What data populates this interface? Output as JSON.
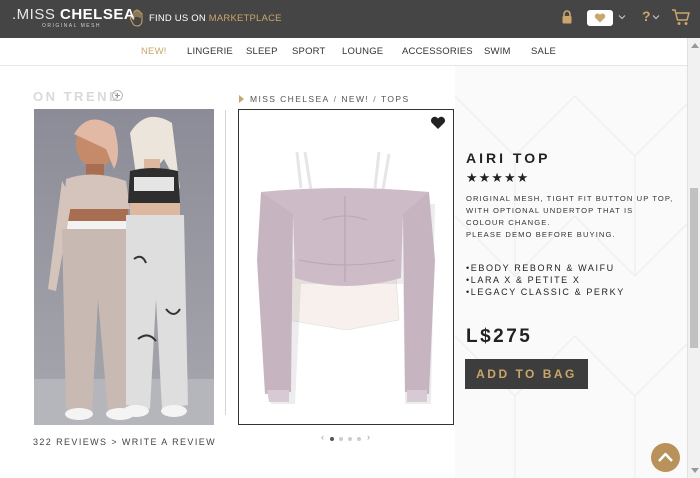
{
  "header": {
    "logo_prefix": ".MISS ",
    "logo_name": "CHELSEA",
    "logo_tagline": "ORIGINAL MESH",
    "find_us_text": "FIND US ON ",
    "find_us_link": "MARKETPLACE",
    "help_label": "?",
    "icons": [
      "hand-icon",
      "lock-icon",
      "heart-icon",
      "chevron-down-icon",
      "help-icon",
      "cart-icon"
    ]
  },
  "nav": {
    "items": [
      "NEW!",
      "LINGERIE",
      "SLEEP",
      "SPORT",
      "LOUNGE",
      "ACCESSORIES",
      "SWIM",
      "SALE"
    ],
    "active": "NEW!"
  },
  "trend": {
    "title": "ON TREND",
    "reviews_count": "322 REVIEWS",
    "reviews_sep": ">",
    "write_review": "WRITE A REVIEW"
  },
  "breadcrumb": {
    "items": [
      "MISS CHELSEA",
      "NEW!",
      "TOPS"
    ],
    "separator": "/"
  },
  "product": {
    "title": "AIRI TOP",
    "rating": 5,
    "stars": "★★★★★",
    "description": [
      "ORIGINAL MESH, TIGHT FIT BUTTON UP TOP,",
      "WITH OPTIONAL UNDERTOP THAT IS",
      "COLOUR CHANGE.",
      "PLEASE DEMO BEFORE BUYING."
    ],
    "bodies": [
      "•EBODY REBORN & WAIFU",
      "•LARA X & PETITE X",
      "•LEGACY CLASSIC & PERKY"
    ],
    "price": "L$275",
    "add_to_bag": "ADD TO BAG"
  },
  "carousel": {
    "total": 4,
    "current": 1,
    "prev": "‹",
    "next": "›"
  },
  "colors": {
    "header_bg": "#454545",
    "accent_gold": "#c9a66b",
    "button_bg": "#3d3d3d"
  }
}
